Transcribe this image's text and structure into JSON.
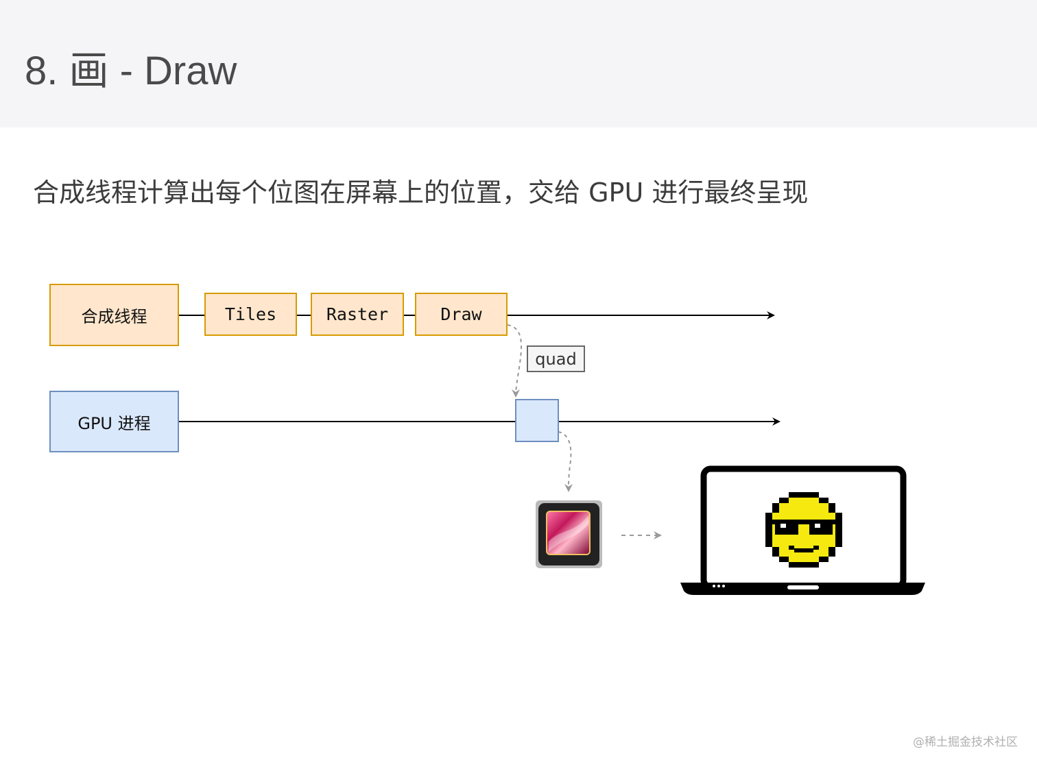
{
  "header": {
    "title": "8. 画 - Draw"
  },
  "description": "合成线程计算出每个位图在屏幕上的位置，交给 GPU 进行最终呈现",
  "diagram": {
    "compositor_thread": "合成线程",
    "tiles": "Tiles",
    "raster": "Raster",
    "draw": "Draw",
    "quad": "quad",
    "gpu_process": "GPU 进程"
  },
  "colors": {
    "orange_fill": "#ffe6cc",
    "orange_stroke": "#d79b00",
    "blue_fill": "#dae8fc",
    "blue_stroke": "#6c8ebf",
    "smiley": "#f5e90f"
  },
  "icons": {
    "gpu_chip": "gpu-chip-icon",
    "laptop": "laptop-icon",
    "smiley": "sunglasses-smiley-icon"
  },
  "watermark": "@稀土掘金技术社区"
}
